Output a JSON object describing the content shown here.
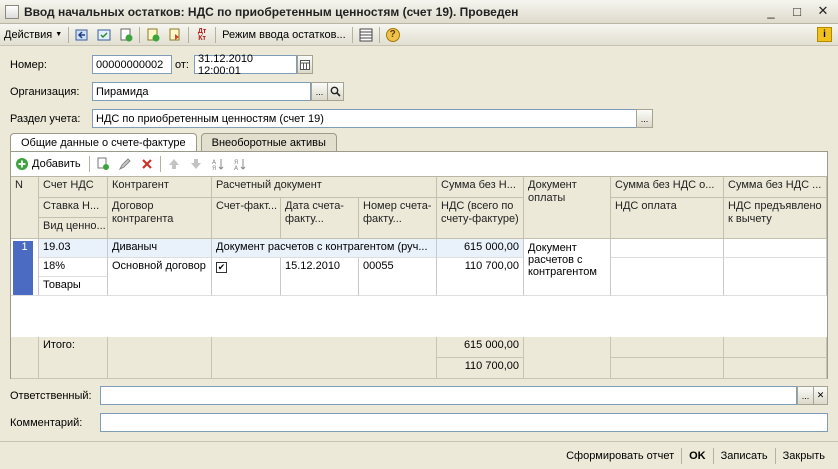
{
  "window": {
    "title": "Ввод начальных остатков: НДС по приобретенным ценностям (счет 19). Проведен",
    "btn_min": "_",
    "btn_max": "□",
    "btn_close": "✕"
  },
  "toolbar": {
    "actions_label": "Действия",
    "mode_label": "Режим ввода остатков...",
    "dt_kt": "Дт Кт",
    "help": "?",
    "info": "i"
  },
  "form": {
    "number_label": "Номер:",
    "number_value": "00000000002",
    "from_label": "от:",
    "date_value": "31.12.2010 12:00:01",
    "org_label": "Организация:",
    "org_value": "Пирамида",
    "section_label": "Раздел учета:",
    "section_value": "НДС по приобретенным ценностям (счет 19)",
    "dots": "..."
  },
  "tabs": [
    {
      "label": "Общие данные о счете-фактуре"
    },
    {
      "label": "Внеоборотные активы"
    }
  ],
  "grid_toolbar": {
    "add_label": "Добавить"
  },
  "grid": {
    "headers": {
      "n": "N",
      "account": "Счет НДС",
      "vat_rate": "Ставка Н...",
      "value_type": "Вид ценно...",
      "counterparty": "Контрагент",
      "contract": "Договор контрагента",
      "settlement_doc": "Расчетный документ",
      "invoice": "Счет-факт...",
      "invoice_date": "Дата счета-факту...",
      "invoice_number": "Номер счета-факту...",
      "sum_no_vat": "Сумма без Н...",
      "vat_total": "НДС (всего по счету-фактуре)",
      "payment_doc": "Документ оплаты",
      "sum_no_vat_paid": "Сумма без НДС о...",
      "vat_paid": "НДС оплата",
      "sum_no_vat_2": "Сумма без НДС ...",
      "vat_deduct": "НДС предъявлено к вычету"
    },
    "row": {
      "n": "1",
      "account": "19.03",
      "vat_rate": "18%",
      "value_type": "Товары",
      "counterparty": "Диваныч",
      "contract": "Основной договор",
      "settlement_doc": "Документ расчетов с контрагентом (руч...",
      "invoice_checked": "✔",
      "invoice_date": "15.12.2010",
      "invoice_number": "00055",
      "sum_no_vat": "615 000,00",
      "vat_total": "110 700,00",
      "payment_doc": "Документ расчетов с контрагентом"
    },
    "footer": {
      "total_label": "Итого:",
      "sum_total": "615 000,00",
      "vat_total": "110 700,00"
    }
  },
  "bottom": {
    "responsible_label": "Ответственный:",
    "comment_label": "Комментарий:",
    "clear": "✕"
  },
  "buttons": {
    "report": "Сформировать отчет",
    "ok": "OK",
    "save": "Записать",
    "close": "Закрыть"
  }
}
